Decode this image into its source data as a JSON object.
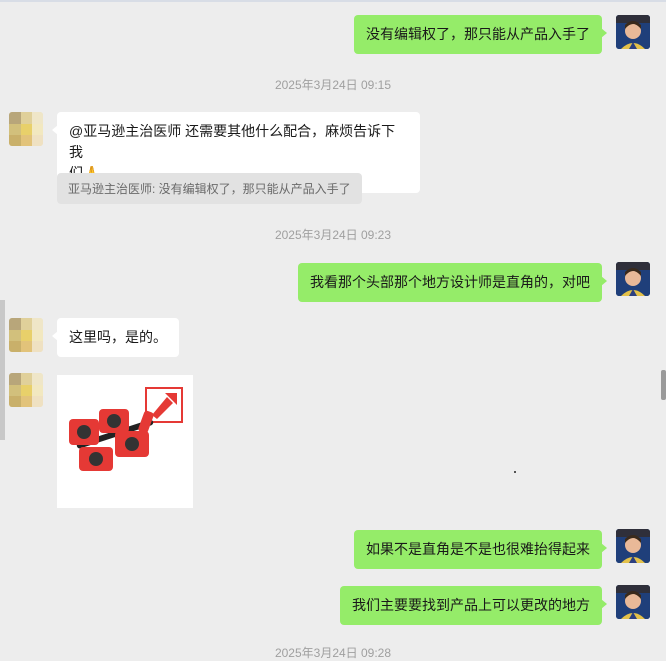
{
  "chat": {
    "messages": [
      {
        "type": "sent",
        "text": "没有编辑权了，那只能从产品入手了"
      },
      {
        "type": "timestamp",
        "text": "2025年3月24日 09:15"
      },
      {
        "type": "received",
        "text_line1": "@亚马逊主治医师 还需要其他什么配合，麻烦告诉下我",
        "text_line2": "们",
        "emoji": "🙏",
        "text_end": "。",
        "quote": "亚马逊主治医师: 没有编辑权了，那只能从产品入手了"
      },
      {
        "type": "timestamp",
        "text": "2025年3月24日 09:23"
      },
      {
        "type": "sent",
        "text": "我看那个头部那个地方设计师是直角的，对吧"
      },
      {
        "type": "received",
        "text": "这里吗，是的。"
      },
      {
        "type": "received_image",
        "alt": "red furniture mover dolly set"
      },
      {
        "type": "sent",
        "text": "如果不是直角是不是也很难抬得起来"
      },
      {
        "type": "sent",
        "text": "我们主要要找到产品上可以更改的地方"
      },
      {
        "type": "timestamp",
        "text": "2025年3月24日 09:28"
      }
    ]
  },
  "colors": {
    "sent_bubble": "#95ec69",
    "received_bubble": "#ffffff",
    "background": "#ededed",
    "timestamp": "#9f9f9f"
  }
}
